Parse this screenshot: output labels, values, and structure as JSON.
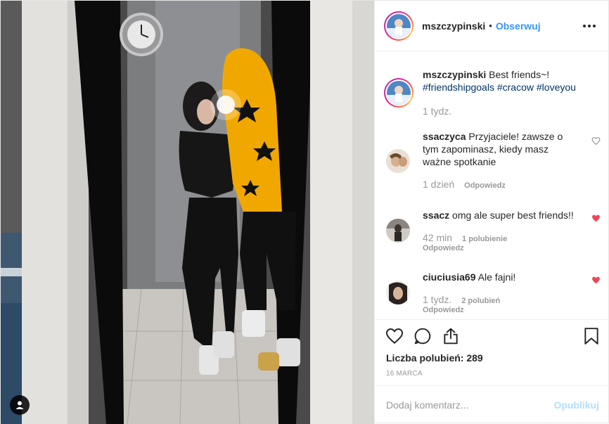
{
  "post": {
    "author": {
      "username": "mszczypinski",
      "separator": "•",
      "follow_label": "Obserwuj"
    },
    "caption": {
      "username": "mszczypinski",
      "text": "Best friends~!",
      "hashtags": [
        "#friendshipgoals",
        "#cracow",
        "#loveyou"
      ],
      "time": "1 tydz."
    },
    "comments": [
      {
        "username": "ssaczyca",
        "text": "Przyjaciele! zawsze o tym zapominasz, kiedy masz ważne spotkanie",
        "time": "1 dzień",
        "likes": "",
        "reply_label": "Odpowiedz",
        "liked": false
      },
      {
        "username": "ssacz",
        "text": "omg ale super best friends!!",
        "time": "42 min",
        "likes": "1 polubienie",
        "reply_label": "Odpowiedz",
        "liked": true
      },
      {
        "username": "ciuciusia69",
        "text": "Ale fajni!",
        "time": "1 tydz.",
        "likes": "2 polubień",
        "reply_label": "Odpowiedz",
        "liked": true
      }
    ],
    "actions": {
      "like_icon": "heart-outline-icon",
      "comment_icon": "speech-bubble-icon",
      "share_icon": "share-icon",
      "save_icon": "bookmark-icon"
    },
    "likes_label": "Liczba polubień: 289",
    "date": "16 MARCA",
    "composer": {
      "placeholder": "Dodaj komentarz...",
      "publish_label": "Opublikuj"
    }
  },
  "colors": {
    "link_blue": "#3897f0",
    "hashtag": "#003569",
    "liked_heart": "#ed4956",
    "muted": "#999999",
    "publish_disabled": "#b2dffc"
  }
}
